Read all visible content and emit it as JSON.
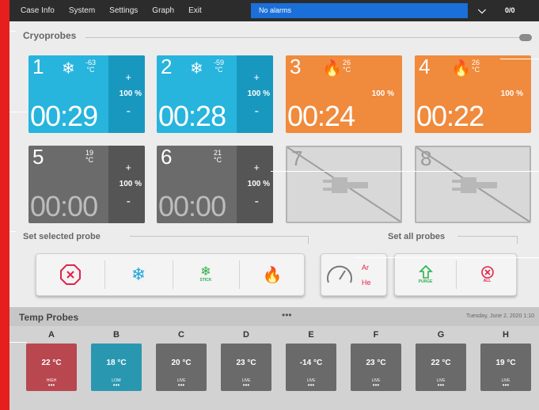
{
  "menu": [
    "Case Info",
    "System",
    "Settings",
    "Graph",
    "Exit"
  ],
  "alarm_text": "No alarms",
  "counter": "0/0",
  "cryoprobes_title": "Cryoprobes",
  "probes": [
    {
      "num": "1",
      "state": "freeze",
      "temp": "-63",
      "unit": "°C",
      "plus": "+",
      "pct": "100 %",
      "minus": "-",
      "time": "00:29"
    },
    {
      "num": "2",
      "state": "freeze",
      "temp": "-59",
      "unit": "°C",
      "plus": "+",
      "pct": "100 %",
      "minus": "-",
      "time": "00:28"
    },
    {
      "num": "3",
      "state": "thaw",
      "temp": "26",
      "unit": "°C",
      "pct": "100 %",
      "time": "00:24"
    },
    {
      "num": "4",
      "state": "thaw",
      "temp": "26",
      "unit": "°C",
      "pct": "100 %",
      "time": "00:22"
    },
    {
      "num": "5",
      "state": "idle",
      "temp": "19",
      "unit": "°C",
      "plus": "+",
      "pct": "100 %",
      "minus": "-",
      "time": "00:00"
    },
    {
      "num": "6",
      "state": "idle",
      "temp": "21",
      "unit": "°C",
      "plus": "+",
      "pct": "100 %",
      "minus": "-",
      "time": "00:00"
    },
    {
      "num": "7",
      "state": "disconnected"
    },
    {
      "num": "8",
      "state": "disconnected"
    }
  ],
  "set_selected_title": "Set selected probe",
  "set_all_title": "Set all probes",
  "stick_label": "STICK",
  "gas_ar": "Ar",
  "gas_he": "He",
  "purge_label": "PURGE",
  "all_label": "ALL",
  "colors": {
    "cyan": "#27b4dd",
    "orange": "#f08a3c",
    "gray": "#6b6b6b",
    "stop_red": "#e0244a",
    "green": "#2bb24c",
    "alarm_blue": "#1a6fd8"
  },
  "temp_probes_title": "Temp Probes",
  "temp_probes_dots": "•••",
  "date_text": "Tuesday, June 2, 2020 1:10",
  "temp_probes": [
    {
      "letter": "A",
      "temp": "22 °C",
      "status": "HIGH",
      "dots": "•••",
      "color": "#b8474f"
    },
    {
      "letter": "B",
      "temp": "18 °C",
      "status": "LOW",
      "dots": "•••",
      "color": "#2a97b0"
    },
    {
      "letter": "C",
      "temp": "20 °C",
      "status": "LIVE",
      "dots": "•••",
      "color": "#6a6a6a"
    },
    {
      "letter": "D",
      "temp": "23 °C",
      "status": "LIVE",
      "dots": "•••",
      "color": "#6a6a6a"
    },
    {
      "letter": "E",
      "temp": "-14 °C",
      "status": "LIVE",
      "dots": "•••",
      "color": "#6a6a6a"
    },
    {
      "letter": "F",
      "temp": "23 °C",
      "status": "LIVE",
      "dots": "•••",
      "color": "#6a6a6a"
    },
    {
      "letter": "G",
      "temp": "22 °C",
      "status": "LIVE",
      "dots": "•••",
      "color": "#6a6a6a"
    },
    {
      "letter": "H",
      "temp": "19 °C",
      "status": "LIVE",
      "dots": "•••",
      "color": "#6a6a6a"
    }
  ]
}
